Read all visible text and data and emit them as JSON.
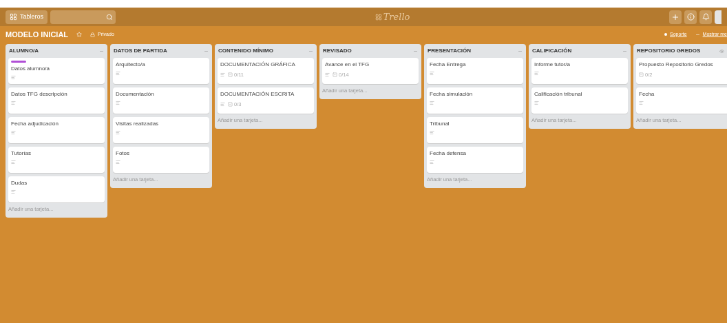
{
  "header": {
    "boards_button": "Tableros",
    "brand": "Trello"
  },
  "board": {
    "title": "MODELO INICIAL",
    "starred": false,
    "visibility": "Privado",
    "links": [
      "Soporte",
      "Mostrar me"
    ]
  },
  "lists": [
    {
      "title": "ALUMNO/A",
      "watched": false,
      "add_card": "Añadir una tarjeta...",
      "cards": [
        {
          "title": "Datos alumno/a",
          "labels": [
            {
              "color": "#b04fd6"
            }
          ],
          "has_description": true
        },
        {
          "title": "Datos TFG descripción",
          "has_description": true
        },
        {
          "title": "Fecha adjudicación",
          "has_description": true
        },
        {
          "title": "Tutorías",
          "has_description": true
        },
        {
          "title": "Dudas",
          "has_description": true
        }
      ]
    },
    {
      "title": "DATOS DE PARTIDA",
      "watched": false,
      "add_card": "Añadir una tarjeta...",
      "cards": [
        {
          "title": "Arquitecto/a",
          "has_description": true
        },
        {
          "title": "Documentación",
          "has_description": true
        },
        {
          "title": "Visitas realizadas",
          "has_description": true
        },
        {
          "title": "Fotos",
          "has_description": true
        }
      ]
    },
    {
      "title": "CONTENIDO MÍNIMO",
      "watched": false,
      "add_card": "Añadir una tarjeta...",
      "cards": [
        {
          "title": "DOCUMENTACIÓN GRÁFICA",
          "has_description": true,
          "checklist": "0/11"
        },
        {
          "title": "DOCUMENTACIÓN ESCRITA",
          "has_description": true,
          "checklist": "0/3"
        }
      ]
    },
    {
      "title": "REVISADO",
      "watched": false,
      "add_card": "Añadir una tarjeta...",
      "cards": [
        {
          "title": "Avance en el TFG",
          "has_description": true,
          "checklist": "0/14"
        }
      ]
    },
    {
      "title": "PRESENTACIÓN",
      "watched": false,
      "add_card": "Añadir una tarjeta...",
      "cards": [
        {
          "title": "Fecha Entrega",
          "has_description": true
        },
        {
          "title": "Fecha simulación",
          "has_description": true
        },
        {
          "title": "Tribunal",
          "has_description": true
        },
        {
          "title": "Fecha defensa",
          "has_description": true
        }
      ]
    },
    {
      "title": "CALIFICACIÓN",
      "watched": false,
      "add_card": "Añadir una tarjeta...",
      "cards": [
        {
          "title": "Informe tutor/a",
          "has_description": true
        },
        {
          "title": "Calificación tribunal",
          "has_description": true
        }
      ]
    },
    {
      "title": "REPOSITORIO GREDOS",
      "watched": true,
      "add_card": "Añadir una tarjeta...",
      "cards": [
        {
          "title": "Propuesto Repositorio Gredos",
          "has_description": false,
          "checklist": "0/2"
        },
        {
          "title": "Fecha",
          "has_description": true
        }
      ]
    }
  ]
}
